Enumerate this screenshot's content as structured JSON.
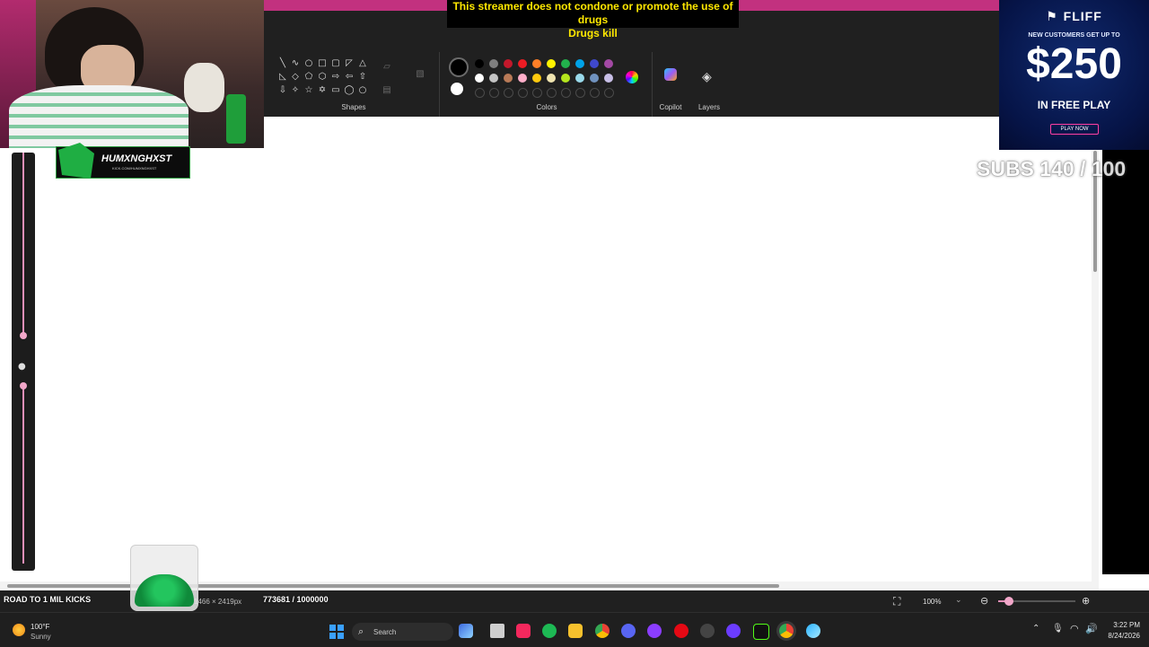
{
  "overlay": {
    "disclaimer_line1": "This streamer does not condone or promote the use of drugs",
    "disclaimer_line2": "Drugs kill",
    "streamer_tag": "HUMXNGHXST",
    "streamer_sub": "KICK.COM/HUMXNGHXST",
    "subs_goal": "SUBS 140 / 100",
    "kicks_label": "ROAD TO 1 MIL KICKS",
    "kicks_count": "773681 / 1000000",
    "kicks_progress": 0.774
  },
  "ad": {
    "brand": "FLIFF",
    "tagline": "NEW CUSTOMERS GET UP TO",
    "amount": "$250",
    "sub": "IN FREE PLAY",
    "cta": "PLAY NOW"
  },
  "ribbon": {
    "shapes_label": "Shapes",
    "colors_label": "Colors",
    "copilot_label": "Copilot",
    "layers_label": "Layers",
    "palette_row1": [
      "#000000",
      "#7f7f7f",
      "#c3182b",
      "#ed1c24",
      "#ff7f27",
      "#fff200",
      "#22b14c",
      "#00a2e8",
      "#3f48cc",
      "#a349a4"
    ],
    "palette_row2": [
      "#ffffff",
      "#c3c3c3",
      "#b97a57",
      "#ffaec9",
      "#ffc90e",
      "#efe4b0",
      "#b5e61d",
      "#99d9ea",
      "#7092be",
      "#c8bfe7"
    ],
    "accent": "#c2317f"
  },
  "status": {
    "dimensions": "1466 × 2419px",
    "zoom": "100%"
  },
  "taskbar": {
    "weather_temp": "100°F",
    "weather_desc": "Sunny",
    "search_placeholder": "Search",
    "time": "3:22 PM",
    "date": "8/24/2026"
  }
}
